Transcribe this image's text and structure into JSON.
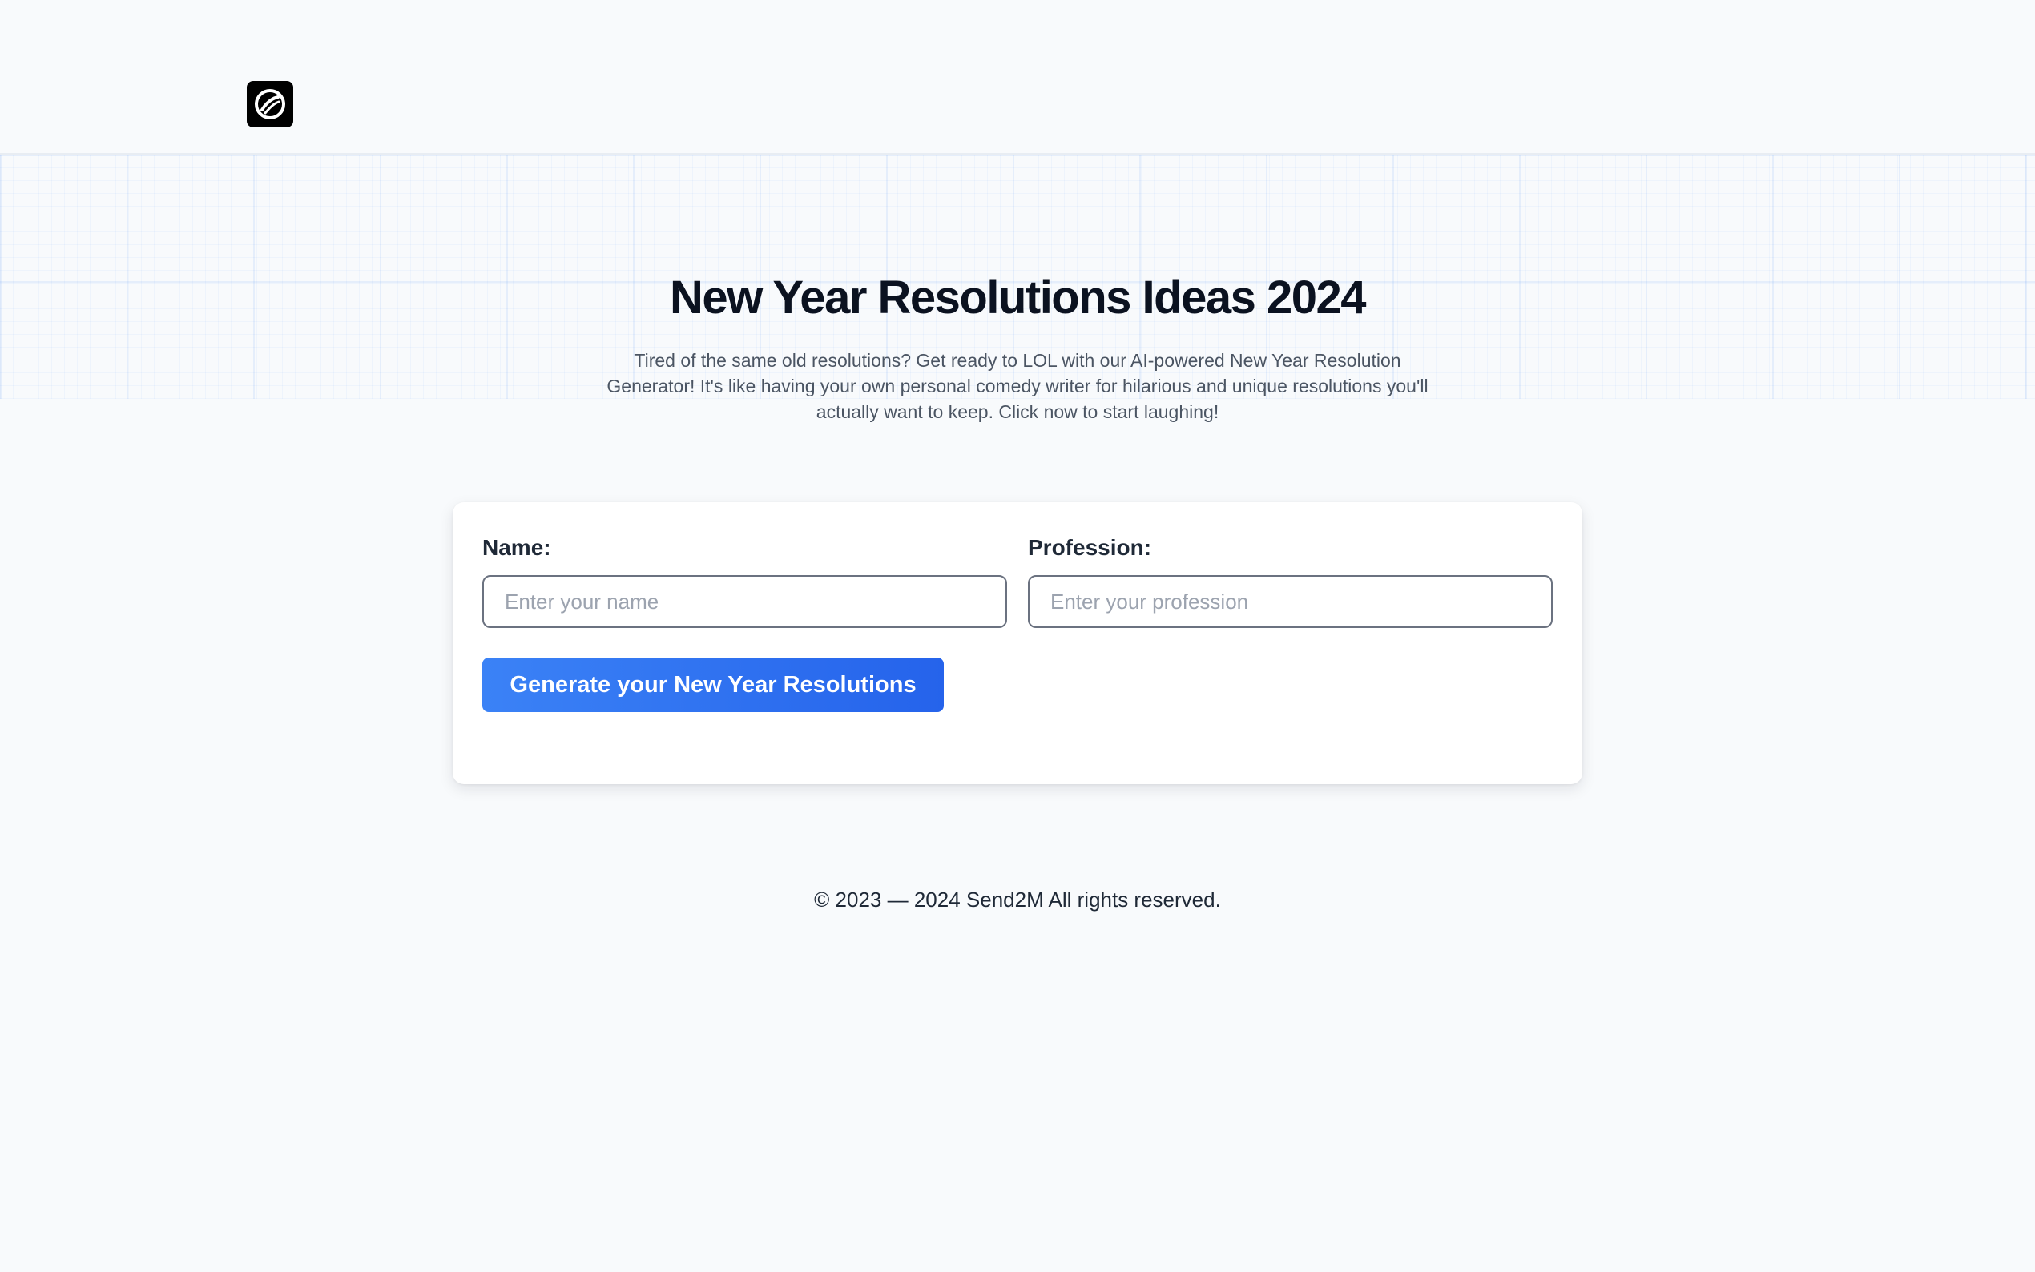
{
  "header": {
    "logo_icon": "circle-slash-icon"
  },
  "hero": {
    "title": "New Year Resolutions Ideas 2024",
    "subtitle": "Tired of the same old resolutions? Get ready to LOL with our AI-powered New Year Resolution Generator! It's like having your own personal comedy writer for hilarious and unique resolutions you'll actually want to keep. Click now to start laughing!"
  },
  "form": {
    "name_label": "Name:",
    "name_placeholder": "Enter your name",
    "name_value": "",
    "profession_label": "Profession:",
    "profession_placeholder": "Enter your profession",
    "profession_value": "",
    "submit_label": "Generate your New Year Resolutions"
  },
  "footer": {
    "copyright": "© 2023 — 2024 Send2M All rights reserved."
  },
  "colors": {
    "background": "#f8fafc",
    "accent": "#2563eb",
    "accent_light": "#3b82f6",
    "text_dark": "#0b1220",
    "text_muted": "#4b5563"
  }
}
